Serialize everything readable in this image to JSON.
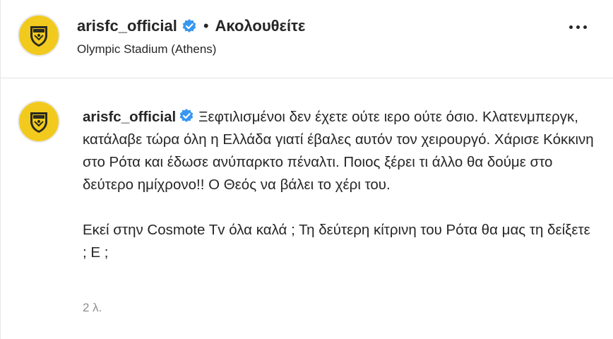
{
  "post_header": {
    "username": "arisfc_official",
    "separator": "•",
    "follow_label": "Ακολουθείτε",
    "location": "Olympic Stadium (Athens)",
    "more_icon": "more-horizontal-icon"
  },
  "comment": {
    "username": "arisfc_official",
    "paragraph1": "Ξεφτιλισμένοι δεν έχετε ούτε ιερο ούτε όσιο. Κλατενμπεργκ, κατάλαβε τώρα όλη η Ελλάδα γιατί έβαλες αυτόν τον χειρουργό. Χάρισε Κόκκινη στο Ρότα και έδωσε ανύπαρκτο πέναλτι. Ποιος ξέρει τι άλλο θα δούμε στο δεύτερο ημίχρονο!! Ο Θεός να βάλει το χέρι του.",
    "paragraph2": "Εκεί στην Cosmote Tv όλα καλά ; Τη δεύτερη κίτρινη του Ρότα θα μας τη δείξετε ; Ε ;",
    "time": "2 λ."
  },
  "colors": {
    "avatar_yellow": "#f2ca1e",
    "verified_blue": "#3897f0",
    "text": "#262626",
    "muted": "#8e8e8e"
  }
}
